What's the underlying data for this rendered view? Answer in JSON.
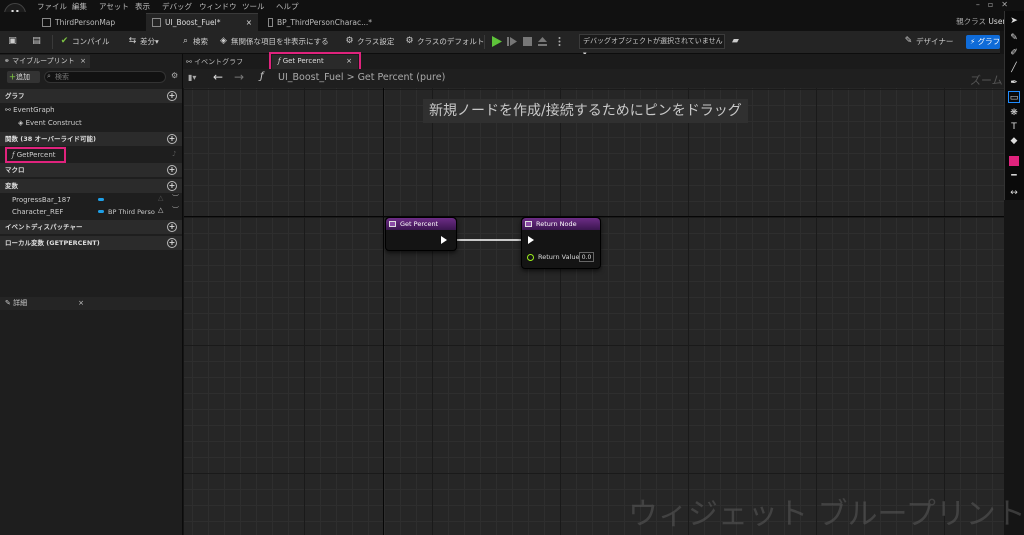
{
  "menu": [
    "ファイル",
    "編集",
    "アセット",
    "表示",
    "デバッグ",
    "ウィンドウ",
    "ツール",
    "ヘルプ"
  ],
  "doc_tabs": [
    {
      "label": "ThirdPersonMap"
    },
    {
      "label": "UI_Boost_Fuel*",
      "close": "×"
    },
    {
      "label": "BP_ThirdPersonCharac...*"
    }
  ],
  "parent_class": {
    "label": "親クラス",
    "value": "User Wid"
  },
  "toolbar": {
    "compile": "コンパイル",
    "diff": "差分",
    "search": "検索",
    "hide_unrelated": "無関係な項目を非表示にする",
    "class_settings": "クラス設定",
    "class_defaults": "クラスのデフォルト",
    "debug_object": "デバッグオブジェクトが選択されていません",
    "designer": "デザイナー",
    "graph": "グラフ"
  },
  "my_blueprint": {
    "tab": "マイブループリント",
    "add": "追加",
    "search_placeholder": "検索",
    "sections": {
      "graphs": "グラフ",
      "functions": "関数 (38 オーバーライド可能)",
      "macros": "マクロ",
      "variables": "変数",
      "event_dispatchers": "イベントディスパッチャー",
      "local_variables": "ローカル変数 (GETPERCENT)"
    },
    "graph_items": [
      "EventGraph",
      "Event Construct"
    ],
    "function_items": [
      "GetPercent"
    ],
    "variables": [
      {
        "name": "ProgressBar_187",
        "type": ""
      },
      {
        "name": "Character_REF",
        "type": "BP Third Perso"
      }
    ]
  },
  "details": {
    "tab": "詳細"
  },
  "graph_tabs": [
    {
      "label": "イベントグラフ"
    },
    {
      "label": "Get Percent",
      "close": "×"
    }
  ],
  "breadcrumb": {
    "blueprint": "UI_Boost_Fuel",
    "sep": ">",
    "function": "Get Percent (pure)"
  },
  "zoom_label": "ズーム",
  "hint": "新規ノードを作成/接続するためにピンをドラッグ",
  "watermark": "ウィジェット ブループリント",
  "nodes": {
    "entry": {
      "title": "Get Percent"
    },
    "return": {
      "title": "Return Node",
      "pin_label": "Return Value",
      "pin_value": "0.0"
    }
  },
  "colors": {
    "accent": "#0f6bd8",
    "highlight": "#e0237d",
    "function_node": "#6d2c86",
    "float_pin": "#9cf01b"
  }
}
